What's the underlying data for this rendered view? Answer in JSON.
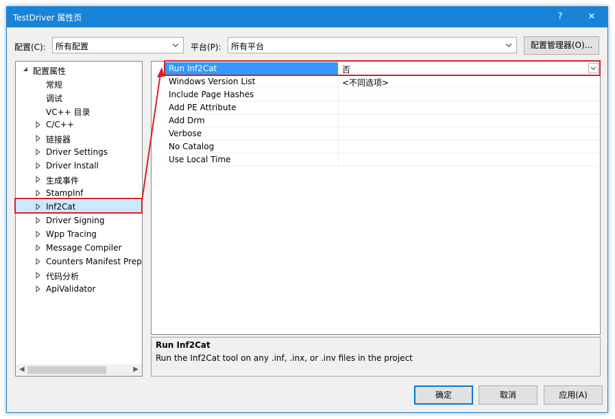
{
  "window": {
    "title": "TestDriver 属性页",
    "help_label": "?",
    "close_label": "✕"
  },
  "config": {
    "label": "配置(C):",
    "value": "所有配置"
  },
  "platform": {
    "label": "平台(P):",
    "value": "所有平台"
  },
  "config_manager_label": "配置管理器(O)...",
  "tree": {
    "root_label": "配置属性",
    "items": [
      {
        "label": "常规",
        "expandable": false
      },
      {
        "label": "调试",
        "expandable": false
      },
      {
        "label": "VC++ 目录",
        "expandable": false
      },
      {
        "label": "C/C++",
        "expandable": true
      },
      {
        "label": "链接器",
        "expandable": true
      },
      {
        "label": "Driver Settings",
        "expandable": true
      },
      {
        "label": "Driver Install",
        "expandable": true
      },
      {
        "label": "生成事件",
        "expandable": true
      },
      {
        "label": "StampInf",
        "expandable": true
      },
      {
        "label": "Inf2Cat",
        "expandable": true,
        "selected": true
      },
      {
        "label": "Driver Signing",
        "expandable": true
      },
      {
        "label": "Wpp Tracing",
        "expandable": true
      },
      {
        "label": "Message Compiler",
        "expandable": true
      },
      {
        "label": "Counters Manifest Preprocessor",
        "expandable": true
      },
      {
        "label": "代码分析",
        "expandable": true
      },
      {
        "label": "ApiValidator",
        "expandable": true
      }
    ]
  },
  "properties": [
    {
      "name": "Run Inf2Cat",
      "value": "否",
      "selected": true
    },
    {
      "name": "Windows Version List",
      "value": "<不同选项>"
    },
    {
      "name": "Include Page Hashes",
      "value": ""
    },
    {
      "name": "Add PE Attribute",
      "value": ""
    },
    {
      "name": "Add Drm",
      "value": ""
    },
    {
      "name": "Verbose",
      "value": ""
    },
    {
      "name": "No Catalog",
      "value": ""
    },
    {
      "name": "Use Local Time",
      "value": ""
    }
  ],
  "description": {
    "title": "Run Inf2Cat",
    "text": "Run the Inf2Cat tool on any .inf, .inx, or .inv files in the project"
  },
  "buttons": {
    "ok": "确定",
    "cancel": "取消",
    "apply": "应用(A)"
  },
  "colors": {
    "titlebar": "#1883d7",
    "selection": "#3399ff",
    "annotation": "#d41f26"
  }
}
